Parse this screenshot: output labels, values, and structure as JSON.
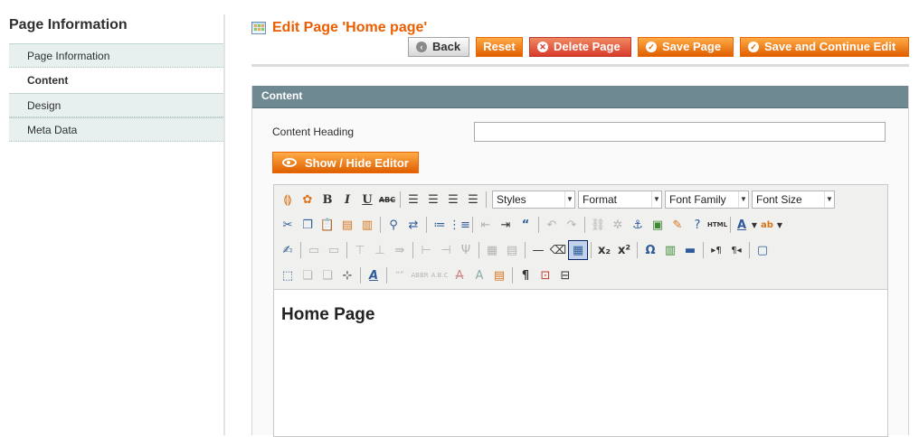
{
  "sidebar": {
    "title": "Page Information",
    "tabs": [
      {
        "label": "Page Information"
      },
      {
        "label": "Content"
      },
      {
        "label": "Design"
      },
      {
        "label": "Meta Data"
      }
    ]
  },
  "header": {
    "title": "Edit Page 'Home page'",
    "buttons": {
      "back": "Back",
      "reset": "Reset",
      "delete": "Delete Page",
      "save": "Save Page",
      "save_continue": "Save and Continue Edit"
    }
  },
  "content": {
    "section_title": "Content",
    "heading_label": "Content Heading",
    "heading_value": "",
    "toggle_editor": "Show / Hide Editor",
    "toolbar": {
      "styles": "Styles",
      "format": "Format",
      "font_family": "Font Family",
      "font_size": "Font Size"
    },
    "editor_heading": "Home Page"
  },
  "colors": {
    "accent": "#eb5e00",
    "button": "#f18200",
    "section_header": "#6f8992"
  }
}
